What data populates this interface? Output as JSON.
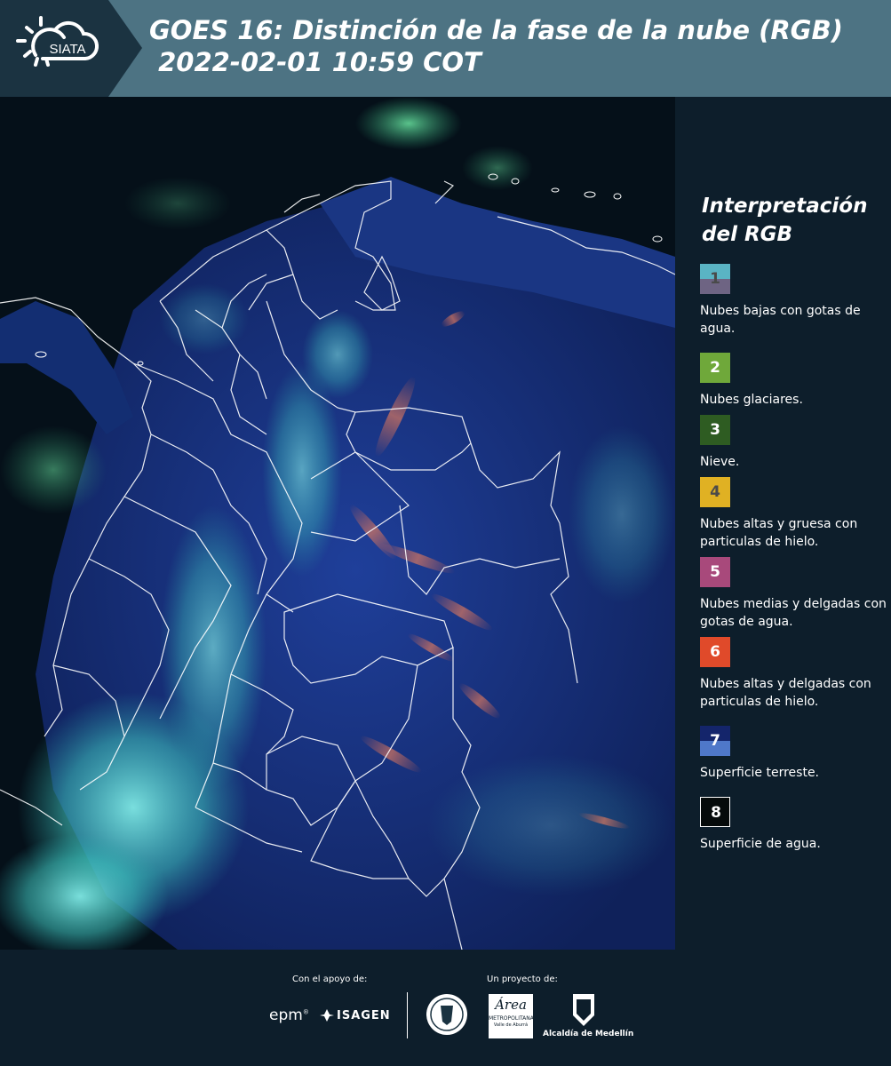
{
  "header": {
    "logo_text": "SIATA",
    "title_line1": "GOES 16: Distinción de la fase de la nube (RGB)",
    "title_line2": " 2022-02-01 10:59 COT"
  },
  "legend": {
    "title": "Interpretación del RGB",
    "items": [
      {
        "num": "1",
        "label": "Nubes bajas con gotas de agua.",
        "color_top": "#5ab4c4",
        "color_bottom": "#6e6483",
        "text_color": "#4a4a4a"
      },
      {
        "num": "2",
        "label": "Nubes glaciares.",
        "color_top": "#6fa83a",
        "color_bottom": "#6fa83a",
        "text_color": "#ffffff"
      },
      {
        "num": "3",
        "label": "Nieve.",
        "color_top": "#2e5c22",
        "color_bottom": "#2e5c22",
        "text_color": "#ffffff"
      },
      {
        "num": "4",
        "label": "Nubes altas y gruesa con particulas de hielo.",
        "color_top": "#e0b123",
        "color_bottom": "#e0b123",
        "text_color": "#4a4a4a"
      },
      {
        "num": "5",
        "label": "Nubes medias y delgadas con gotas de agua.",
        "color_top": "#a8497b",
        "color_bottom": "#a8497b",
        "text_color": "#ffffff"
      },
      {
        "num": "6",
        "label": "Nubes altas y delgadas con particulas de hielo.",
        "color_top": "#e04a2a",
        "color_bottom": "#e04a2a",
        "text_color": "#ffffff"
      },
      {
        "num": "7",
        "label": "Superficie terreste.",
        "color_top": "#14256b",
        "color_bottom": "#4f78c9",
        "text_color": "#ffffff"
      },
      {
        "num": "8",
        "label": "Superficie de agua.",
        "color_top": "#050a0a",
        "color_bottom": "#050a0a",
        "text_color": "#ffffff"
      }
    ]
  },
  "footer": {
    "support_label": "Con el apoyo de:",
    "project_label": "Un proyecto de:",
    "epm": "epm",
    "isagen": "ISAGEN",
    "area_name": "Área",
    "area_sub": "METROPOLITANA",
    "area_sub2": "Valle de Aburrá",
    "alcaldia": "Alcaldía de Medellín"
  }
}
